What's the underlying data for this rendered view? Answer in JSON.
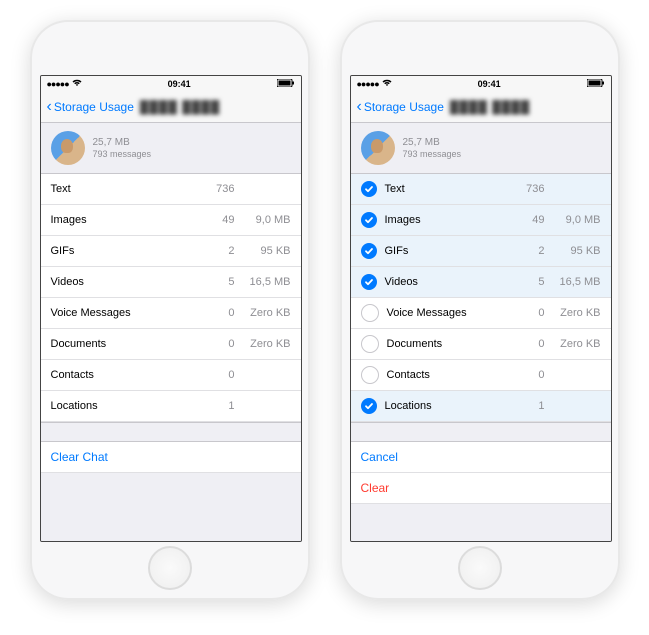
{
  "status": {
    "time": "09:41"
  },
  "nav": {
    "back": "Storage Usage",
    "contact": "████ ████"
  },
  "summary": {
    "size": "25,7 MB",
    "messages": "793 messages"
  },
  "categories": [
    {
      "label": "Text",
      "count": "736",
      "bytes": "",
      "selected": true
    },
    {
      "label": "Images",
      "count": "49",
      "bytes": "9,0 MB",
      "selected": true
    },
    {
      "label": "GIFs",
      "count": "2",
      "bytes": "95 KB",
      "selected": true
    },
    {
      "label": "Videos",
      "count": "5",
      "bytes": "16,5 MB",
      "selected": true
    },
    {
      "label": "Voice Messages",
      "count": "0",
      "bytes": "Zero KB",
      "selected": false
    },
    {
      "label": "Documents",
      "count": "0",
      "bytes": "Zero KB",
      "selected": false
    },
    {
      "label": "Contacts",
      "count": "0",
      "bytes": "",
      "selected": false
    },
    {
      "label": "Locations",
      "count": "1",
      "bytes": "",
      "selected": true
    }
  ],
  "actions": {
    "clear_chat": "Clear Chat",
    "cancel": "Cancel",
    "clear": "Clear"
  }
}
